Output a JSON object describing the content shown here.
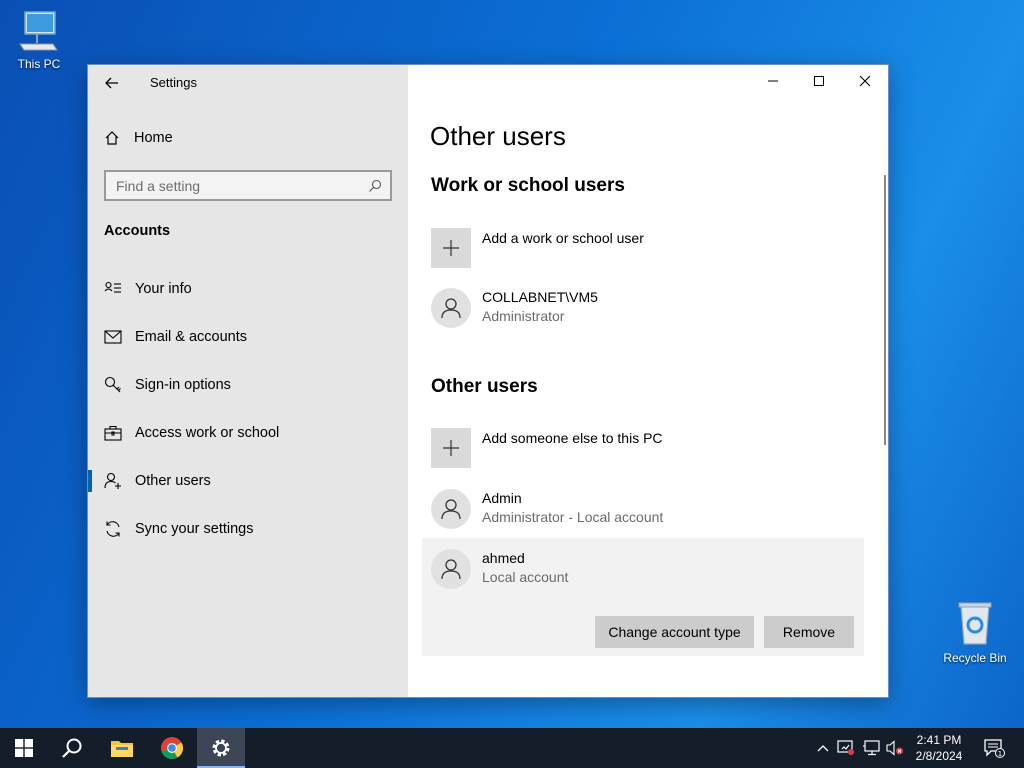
{
  "desktop": {
    "this_pc_label": "This PC",
    "recycle_bin_label": "Recycle Bin"
  },
  "window": {
    "title": "Settings",
    "controls": {
      "minimize": "minimize-icon",
      "maximize": "maximize-icon",
      "close": "close-icon"
    }
  },
  "sidebar": {
    "home_label": "Home",
    "search_placeholder": "Find a setting",
    "section_label": "Accounts",
    "items": [
      {
        "label": "Your info",
        "icon": "your-info-icon"
      },
      {
        "label": "Email & accounts",
        "icon": "mail-icon"
      },
      {
        "label": "Sign-in options",
        "icon": "key-icon"
      },
      {
        "label": "Access work or school",
        "icon": "briefcase-icon"
      },
      {
        "label": "Other users",
        "icon": "add-person-icon",
        "active": true
      },
      {
        "label": "Sync your settings",
        "icon": "sync-icon"
      }
    ]
  },
  "main": {
    "page_title": "Other users",
    "work_section": {
      "title": "Work or school users",
      "add_label": "Add a work or school user",
      "users": [
        {
          "name": "COLLABNET\\VM5",
          "role": "Administrator"
        }
      ]
    },
    "other_section": {
      "title": "Other users",
      "add_label": "Add someone else to this PC",
      "users": [
        {
          "name": "Admin",
          "role": "Administrator - Local account"
        },
        {
          "name": "ahmed",
          "role": "Local account",
          "expanded": true
        }
      ]
    },
    "actions": {
      "change_type_label": "Change account type",
      "remove_label": "Remove"
    }
  },
  "taskbar": {
    "apps": [
      "start",
      "search",
      "file-explorer",
      "chrome",
      "settings"
    ],
    "active_app": "settings",
    "clock": {
      "time": "2:41 PM",
      "date": "2/8/2024"
    },
    "notification_count": "1"
  },
  "colors": {
    "accent": "#0063b1",
    "sidebar_bg": "#e6e6e6",
    "taskbar_bg": "#141d2a"
  }
}
